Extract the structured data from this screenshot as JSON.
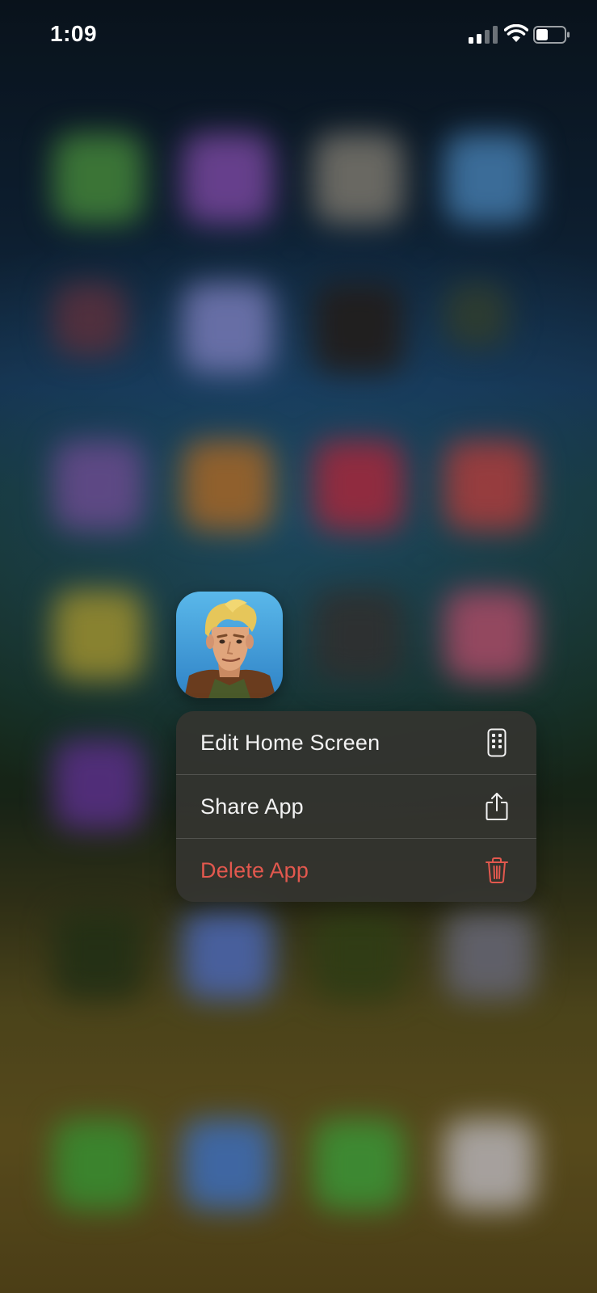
{
  "status_bar": {
    "time": "1:09",
    "signal_icon": "cellular-signal-icon",
    "wifi_icon": "wifi-icon",
    "battery_icon": "battery-icon"
  },
  "app": {
    "icon": "fortnite-app-icon"
  },
  "context_menu": {
    "items": [
      {
        "label": "Edit Home Screen",
        "icon": "phone-grid-icon",
        "style": "default"
      },
      {
        "label": "Share App",
        "icon": "share-icon",
        "style": "default"
      },
      {
        "label": "Delete App",
        "icon": "trash-icon",
        "style": "destructive",
        "color": "#e2584e"
      }
    ]
  },
  "colors": {
    "menu_background": "#343430",
    "destructive": "#e2584e",
    "text": "#f2f2f2"
  }
}
